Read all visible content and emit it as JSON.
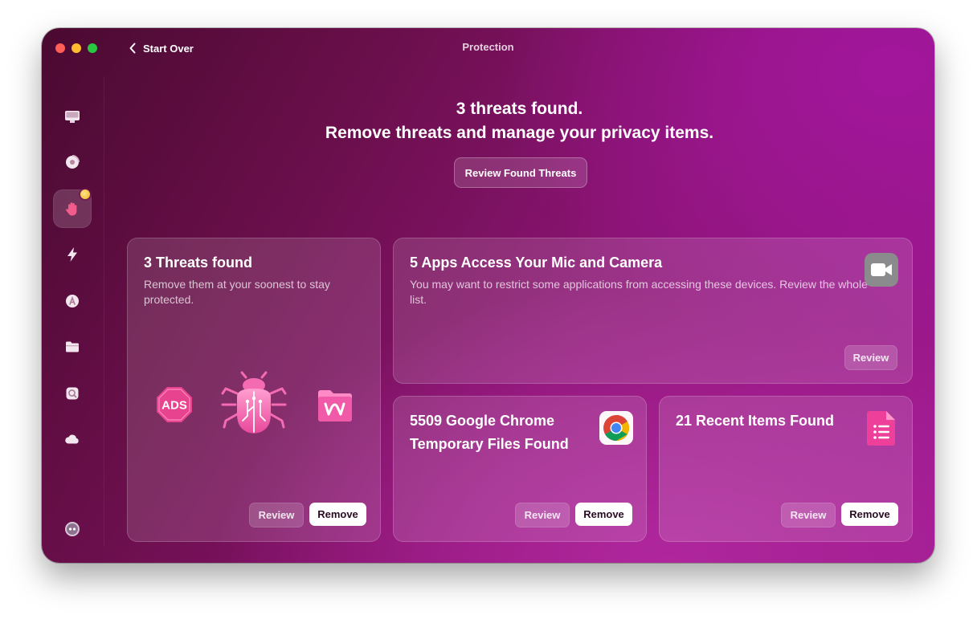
{
  "window": {
    "title": "Protection",
    "back_label": "Start Over"
  },
  "sidebar": {
    "items": [
      {
        "icon": "monitor-icon"
      },
      {
        "icon": "shield-disc-icon"
      },
      {
        "icon": "hand-icon",
        "active": true,
        "badge": true
      },
      {
        "icon": "lightning-icon"
      },
      {
        "icon": "apps-icon"
      },
      {
        "icon": "folder-icon"
      },
      {
        "icon": "search-icon"
      },
      {
        "icon": "cloud-icon"
      },
      {
        "icon": "assistant-icon"
      }
    ]
  },
  "headline": {
    "line1": "3 threats found.",
    "line2": "Remove threats and manage your privacy items.",
    "button_label": "Review Found Threats"
  },
  "cards": {
    "threats": {
      "title": "3 Threats found",
      "description": "Remove them at your soonest to stay protected.",
      "ads_label": "ADS",
      "review_label": "Review",
      "remove_label": "Remove"
    },
    "mic_camera": {
      "title": "5 Apps Access Your Mic and Camera",
      "description": "You may want to restrict some applications from accessing these devices. Review the whole list.",
      "review_label": "Review"
    },
    "chrome": {
      "title": "5509 Google Chrome Temporary Files Found",
      "review_label": "Review",
      "remove_label": "Remove"
    },
    "recent": {
      "title": "21 Recent Items Found",
      "review_label": "Review",
      "remove_label": "Remove"
    }
  },
  "colors": {
    "accent_pink": "#ec4fb0",
    "traffic_red": "#fe5f57",
    "traffic_yellow": "#febc2e",
    "traffic_green": "#28c840"
  }
}
